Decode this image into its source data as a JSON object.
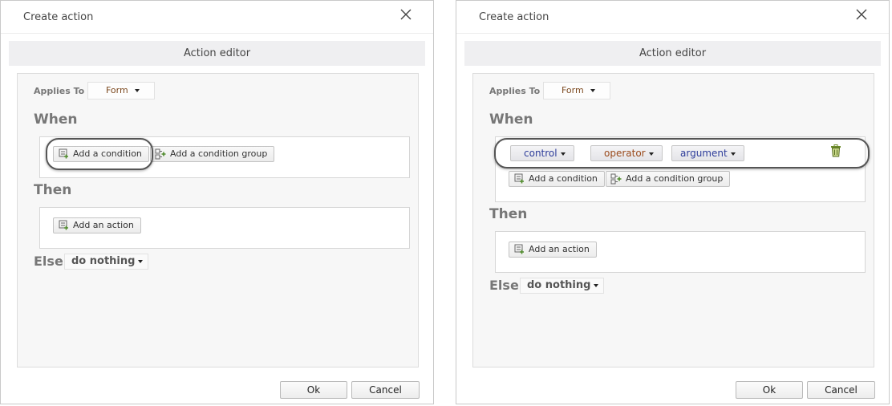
{
  "left": {
    "title": "Create action",
    "editor_tab": "Action editor",
    "applies_to_label": "Applies To",
    "applies_to_value": "Form",
    "when_label": "When",
    "add_condition": "Add a condition",
    "add_condition_group": "Add a condition group",
    "then_label": "Then",
    "add_action": "Add an action",
    "else_label": "Else",
    "else_value": "do nothing",
    "ok": "Ok",
    "cancel": "Cancel"
  },
  "right": {
    "title": "Create action",
    "editor_tab": "Action editor",
    "applies_to_label": "Applies To",
    "applies_to_value": "Form",
    "when_label": "When",
    "condition": {
      "control": "control",
      "operator": "operator",
      "argument": "argument"
    },
    "add_condition": "Add a condition",
    "add_condition_group": "Add a condition group",
    "then_label": "Then",
    "add_action": "Add an action",
    "else_label": "Else",
    "else_value": "do nothing",
    "ok": "Ok",
    "cancel": "Cancel"
  },
  "colors": {
    "accent_green": "#4e8a2a",
    "control_text": "#2d3c9a",
    "operator_text": "#9a4a1c",
    "form_text": "#7d4a20"
  },
  "icons": [
    "close-icon",
    "add-condition-icon",
    "add-condition-group-icon",
    "add-action-icon",
    "trash-icon"
  ]
}
